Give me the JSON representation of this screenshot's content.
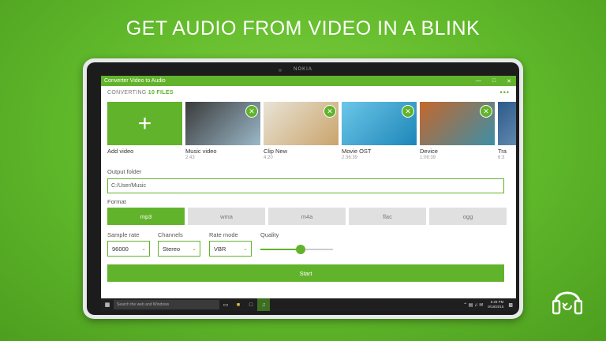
{
  "promo": {
    "headline": "GET AUDIO FROM VIDEO IN A  BLINK"
  },
  "device": {
    "brand": "NOKIA"
  },
  "window": {
    "title": "Converter Video to Audio",
    "controls": [
      "—",
      "□",
      "✕"
    ]
  },
  "header": {
    "converting_prefix": "CONVERTING",
    "converting_count": "10 FILES",
    "more": "•••"
  },
  "tiles": [
    {
      "name": "Add video",
      "duration": "",
      "kind": "add",
      "icon": "plus-icon"
    },
    {
      "name": "Music video",
      "duration": "2:43",
      "kind": "video",
      "colors": [
        "#3b3b3b",
        "#9ab8c8"
      ]
    },
    {
      "name": "Clip New",
      "duration": "4:20",
      "kind": "video",
      "colors": [
        "#e9e3d6",
        "#c9a46b"
      ]
    },
    {
      "name": "Movie OST",
      "duration": "2:36:39",
      "kind": "video",
      "colors": [
        "#6cc6e8",
        "#1d86b8"
      ]
    },
    {
      "name": "Device",
      "duration": "1:06:39",
      "kind": "video",
      "colors": [
        "#c4672c",
        "#3c8fa8"
      ]
    },
    {
      "name": "Tra",
      "duration": "6:3",
      "kind": "video",
      "colors": [
        "#2d5a8a",
        "#8fb3d0"
      ]
    }
  ],
  "output": {
    "label": "Output folder",
    "value": "C:/User/Music"
  },
  "format": {
    "label": "Format",
    "options": [
      "mp3",
      "wma",
      "m4a",
      "flac",
      "ogg"
    ],
    "selected": "mp3"
  },
  "settings": {
    "sample_rate": {
      "label": "Sample rate",
      "value": "96000"
    },
    "channels": {
      "label": "Channels",
      "value": "Stereo"
    },
    "rate_mode": {
      "label": "Rate mode",
      "value": "VBR"
    },
    "quality": {
      "label": "Quality",
      "level": 0.55
    }
  },
  "actions": {
    "start": "Start"
  },
  "taskbar": {
    "search_placeholder": "Search the web and Windows",
    "time": "5:28 PM",
    "date": "9/18/2015"
  },
  "colors": {
    "accent": "#62b32c",
    "background": "#5fb82a"
  }
}
